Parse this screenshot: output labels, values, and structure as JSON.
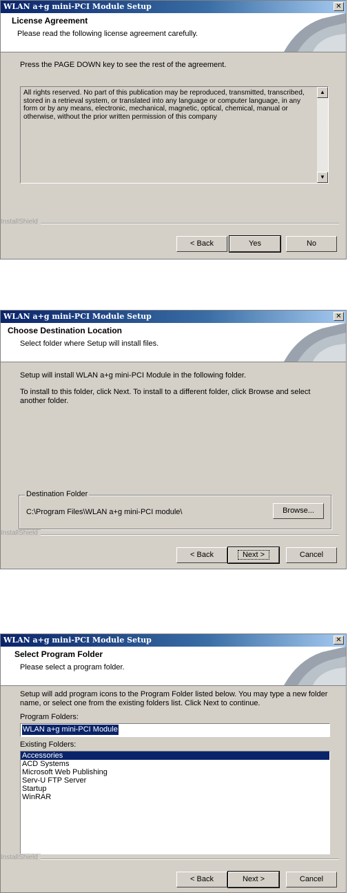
{
  "license_dialog": {
    "window_title": "WLAN a+g mini-PCI Module Setup",
    "close_glyph": "✕",
    "header_title": "License Agreement",
    "header_subtitle": "Please read the following license agreement carefully.",
    "instruction": "Press the PAGE DOWN key to see the rest of the agreement.",
    "license_text": "All rights reserved. No part of this publication may be reproduced, transmitted, transcribed, stored in a retrieval system, or translated into any language or computer language, in any form or by any means, electronic, mechanical, magnetic, optical, chemical, manual or otherwise, without the prior written permission of this company",
    "scroll_up_glyph": "▲",
    "scroll_down_glyph": "▼",
    "brand": "InstallShield",
    "buttons": {
      "back": "< Back",
      "yes": "Yes",
      "no": "No"
    }
  },
  "destination_dialog": {
    "window_title": "WLAN a+g mini-PCI Module Setup",
    "close_glyph": "✕",
    "header_title": "Choose Destination Location",
    "header_subtitle": "Select folder where Setup will install files.",
    "line1": "Setup will install WLAN a+g mini-PCI Module in the following folder.",
    "line2": "To install to this folder, click Next. To install to a different folder, click Browse and select another folder.",
    "group_label": "Destination Folder",
    "folder_path": "C:\\Program Files\\WLAN a+g mini-PCI module\\",
    "browse_button": "Browse...",
    "brand": "InstallShield",
    "buttons": {
      "back": "< Back",
      "next": "Next >",
      "cancel": "Cancel"
    }
  },
  "program_folder_dialog": {
    "window_title": "WLAN a+g mini-PCI Module Setup",
    "close_glyph": "✕",
    "header_title": "Select Program Folder",
    "header_subtitle": "Please select a program folder.",
    "instruction": "Setup will add program icons to the Program Folder listed below.  You may type a new folder name, or select one from the existing folders list.  Click Next to continue.",
    "program_folders_label": "Program Folders:",
    "program_folder_value": "WLAN a+g mini-PCI Module",
    "existing_folders_label": "Existing Folders:",
    "existing_folders": [
      "Accessories",
      "ACD Systems",
      "Microsoft Web Publishing",
      "Serv-U FTP Server",
      "Startup",
      "WinRAR"
    ],
    "selected_folder": "Accessories",
    "brand": "InstallShield",
    "buttons": {
      "back": "< Back",
      "next": "Next >",
      "cancel": "Cancel"
    }
  },
  "colors": {
    "titlebar_start": "#0a246a",
    "titlebar_end": "#a6caf0",
    "dialog_face": "#d4d0c8",
    "selection": "#0a246a"
  },
  "icons": [
    "close-icon",
    "installshield-header-graphic",
    "scroll-up-arrow-icon",
    "scroll-down-arrow-icon"
  ]
}
